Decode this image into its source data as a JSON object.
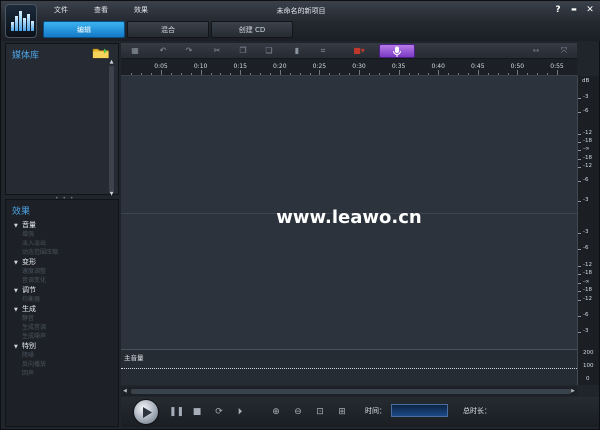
{
  "window": {
    "title": "未命名的新项目"
  },
  "menu": [
    "文件",
    "查看",
    "效果"
  ],
  "window_controls": {
    "help": "?",
    "minimize": "▬",
    "close": "✕"
  },
  "tabs": [
    {
      "label": "编辑",
      "active": true
    },
    {
      "label": "混合",
      "active": false
    },
    {
      "label": "创建 CD",
      "active": false
    }
  ],
  "media_library": {
    "title": "媒体库",
    "icon": "folder-add-icon"
  },
  "effects_panel": {
    "title": "效果",
    "categories": [
      {
        "label": "音量",
        "items": [
          "增强",
          "淡入淡出",
          "动态范围压缩"
        ]
      },
      {
        "label": "变形",
        "items": [
          "速度调整",
          "音调变化"
        ]
      },
      {
        "label": "调节",
        "items": [
          "均衡器"
        ]
      },
      {
        "label": "生成",
        "items": [
          "静音",
          "生成音调",
          "生成噪声"
        ]
      },
      {
        "label": "特别",
        "items": [
          "降噪",
          "反向播放",
          "回声"
        ]
      }
    ]
  },
  "toolbar": {
    "icons": [
      "save-icon",
      "undo-icon",
      "redo-icon",
      "cut-icon",
      "copy-icon",
      "paste-icon",
      "delete-icon",
      "crop-icon",
      "record-icon",
      "microphone-icon",
      "fit-width-icon",
      "fit-all-icon"
    ],
    "accent": "#9b59d9"
  },
  "ruler": {
    "labels": [
      "0:05",
      "0:10",
      "0:15",
      "0:20",
      "0:25",
      "0:30",
      "0:35",
      "0:40",
      "0:45",
      "0:50",
      "0:55"
    ]
  },
  "watermark": "www.leawo.cn",
  "db_scale": {
    "unit": "dB",
    "upper": [
      "-3",
      "-6",
      "-12",
      "-18",
      "-∞",
      "-18",
      "-12",
      "-6",
      "-3"
    ],
    "lower": [
      "-3",
      "-6",
      "-12",
      "-18",
      "-∞",
      "-18",
      "-12",
      "-6",
      "-3"
    ]
  },
  "master_lane": {
    "label": "主音量",
    "scale": [
      "200",
      "100",
      "0"
    ]
  },
  "transport": {
    "icons": [
      "play-icon",
      "pause-icon",
      "stop-icon",
      "loop-icon",
      "next-icon",
      "zoom-in-icon",
      "zoom-out-icon",
      "zoom-fit-icon",
      "zoom-selection-icon"
    ],
    "time_label": "时间：",
    "total_label": "总时长："
  }
}
